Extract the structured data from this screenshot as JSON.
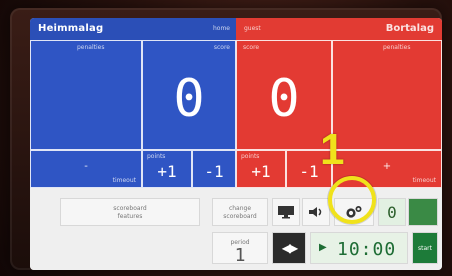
{
  "header": {
    "left_team": "Heimmalag",
    "left_small": "home",
    "right_small": "guest",
    "right_team": "Bortalag"
  },
  "panels": {
    "left_label": "penalties",
    "left_score_label": "score",
    "right_score_label": "score",
    "right_label": "penalties",
    "home_score": "0",
    "guest_score": "0"
  },
  "controls": {
    "minus_symbol": "-",
    "minus_caption": "timeout",
    "plus_symbol": "+",
    "plus_caption": "timeout",
    "points_label_left": "points",
    "points_label_right": "points",
    "p1": "+1",
    "m1": "-1",
    "p1b": "+1",
    "m1b": "-1"
  },
  "bottom": {
    "info_text": "scoreboard\nfeatures",
    "player_text": "change\nscoreboard",
    "period_label": "period",
    "period_value": "1",
    "timer_value": "10:00",
    "last_value": "0",
    "start_label": "start",
    "swap_icon": "swap-arrows-icon",
    "monitor_icon": "monitor-icon",
    "sound_icon": "speaker-icon",
    "settings_icon": "gear-icon"
  },
  "annotation": {
    "number": "1"
  }
}
